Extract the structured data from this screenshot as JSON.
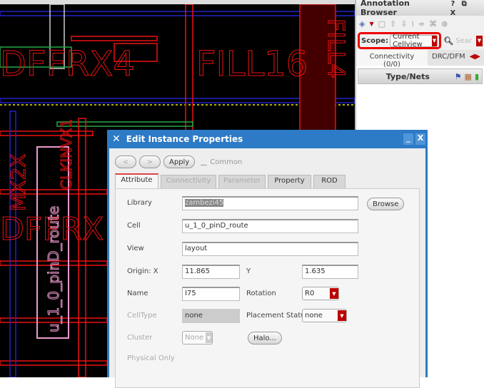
{
  "layout": {
    "labels": [
      "DFFRX4",
      "FILL16",
      "FILL4",
      "MX2X",
      "CLKINVX1",
      "DFFRX",
      "u_1_0_pinD_route"
    ]
  },
  "annotation_browser": {
    "title": "Annotation Browser",
    "title_buttons": [
      "?",
      "⧉",
      "X"
    ],
    "scope_label": "Scope:",
    "scope_value": "Current Cellview",
    "search_placeholder": "Sear",
    "tabs": [
      "Connectivity (0/0)",
      "DRC/DFM"
    ],
    "column_header": "Type/Nets"
  },
  "dialog": {
    "title": "Edit Instance Properties",
    "prev_label": "<",
    "next_label": ">",
    "apply_label": "Apply",
    "common_label": "Common",
    "tabs": [
      "Attribute",
      "Connectivity",
      "Parameter",
      "Property",
      "ROD"
    ],
    "fields": {
      "library_label": "Library",
      "library": "zambezi45",
      "browse_label": "Browse",
      "cell_label": "Cell",
      "cell": "u_1_0_pinD_route",
      "view_label": "View",
      "view": "layout",
      "origin_label": "Origin:  X",
      "origin_x": "11.865",
      "y_label": "Y",
      "origin_y": "1.635",
      "name_label": "Name",
      "name": "I75",
      "rotation_label": "Rotation",
      "rotation": "R0",
      "celltype_label": "CellType",
      "celltype": "none",
      "placement_label": "Placement Status",
      "placement": "none",
      "cluster_label": "Cluster",
      "cluster": "None",
      "halo_label": "Halo...",
      "physical_only_label": "Physical Only"
    }
  }
}
